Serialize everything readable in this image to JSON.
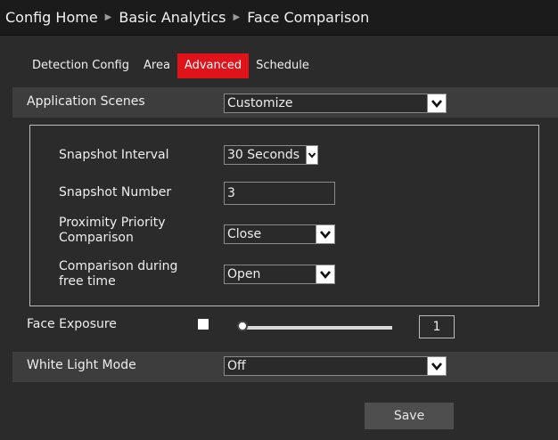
{
  "breadcrumb": {
    "items": [
      "Config Home",
      "Basic Analytics",
      "Face Comparison"
    ],
    "separator": "▶"
  },
  "tabs": [
    {
      "label": "Detection Config",
      "active": false
    },
    {
      "label": "Area",
      "active": false
    },
    {
      "label": "Advanced",
      "active": true
    },
    {
      "label": "Schedule",
      "active": false
    }
  ],
  "application_scenes": {
    "label": "Application Scenes",
    "value": "Customize"
  },
  "snapshot_interval": {
    "label": "Snapshot Interval",
    "value": "30 Seconds"
  },
  "snapshot_number": {
    "label": "Snapshot Number",
    "value": "3"
  },
  "proximity_priority": {
    "label_line1": "Proximity Priority",
    "label_line2": "Comparison",
    "value": "Close"
  },
  "comparison_free_time": {
    "label_line1": "Comparison during",
    "label_line2": "free time",
    "value": "Open"
  },
  "face_exposure": {
    "label": "Face Exposure",
    "enabled": false,
    "slider_value": "1"
  },
  "white_light_mode": {
    "label": "White Light Mode",
    "value": "Off"
  },
  "save_label": "Save",
  "colors": {
    "accent": "#e0121a",
    "background": "#2b2b2b",
    "band": "#3d3d3d"
  }
}
